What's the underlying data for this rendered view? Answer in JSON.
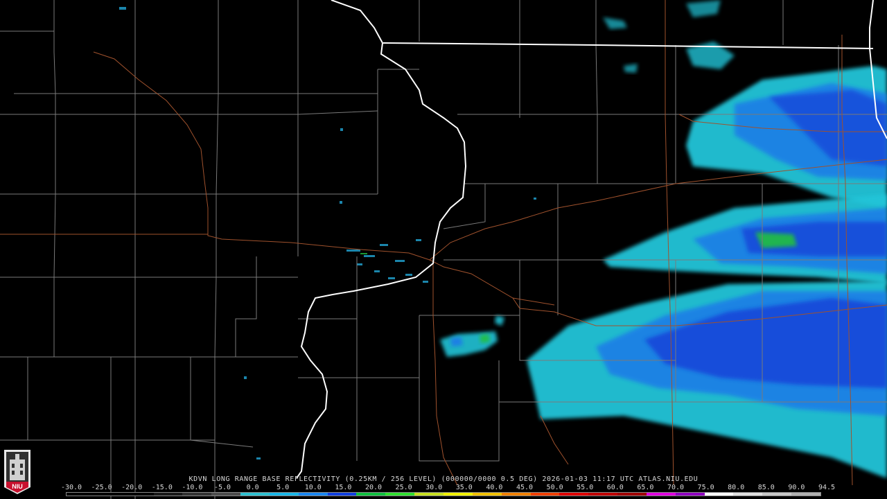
{
  "product": {
    "station": "KDVN",
    "caption": "KDVN LONG RANGE BASE REFLECTIVITY (0.25KM / 256 LEVEL) (000000/0000 0.5 DEG) 2026-01-03 11:17 UTC  ATLAS.NIU.EDU"
  },
  "logo": {
    "text": "NIU",
    "color": "#c8102e"
  },
  "scale": {
    "labels": [
      "-30.0",
      "-25.0",
      "-20.0",
      "-15.0",
      "-10.0",
      "-5.0",
      "0.0",
      "5.0",
      "10.0",
      "15.0",
      "20.0",
      "25.0",
      "30.0",
      "35.0",
      "40.0",
      "45.0",
      "50.0",
      "55.0",
      "60.0",
      "65.0",
      "70.0",
      "75.0",
      "80.0",
      "85.0",
      "90.0",
      "94.5"
    ],
    "colors": [
      "#000000",
      "#000000",
      "#000000",
      "#1a1a1a",
      "#333333",
      "#4d4d4d",
      "#2ec0d0",
      "#18b6e8",
      "#1a86f0",
      "#1040e0",
      "#10c040",
      "#30e030",
      "#c8e020",
      "#f0f000",
      "#f0c000",
      "#f08000",
      "#f04000",
      "#e00000",
      "#c00000",
      "#a00000",
      "#e000e0",
      "#9000c0",
      "#ffffff",
      "#e0e0e0",
      "#c8c8c8",
      "#b0b0b0"
    ]
  },
  "map": {
    "background": "#000000",
    "county_line_color": "#7a7a7a",
    "state_line_color": "#ffffff",
    "highway_color": "#a0522d"
  }
}
